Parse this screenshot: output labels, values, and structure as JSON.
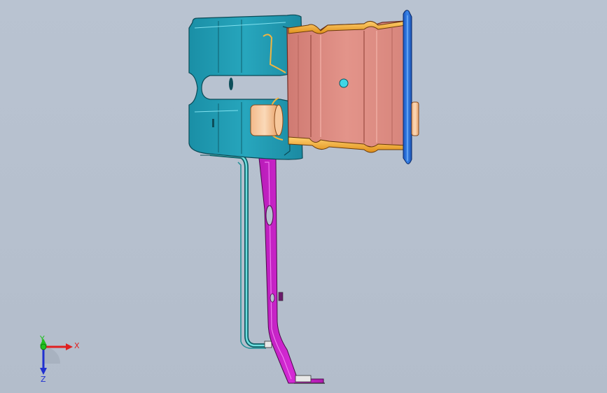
{
  "viewport": {
    "background": "#b7c1cf"
  },
  "model": {
    "parts": [
      {
        "name": "teal-bracket-housing",
        "color": "#1f9ab0"
      },
      {
        "name": "salmon-channel-body",
        "color": "#e08a80"
      },
      {
        "name": "orange-flange-edge",
        "color": "#f0a020"
      },
      {
        "name": "blue-end-flange",
        "color": "#2a6fd8"
      },
      {
        "name": "magenta-support-strap",
        "color": "#cc22cc"
      },
      {
        "name": "teal-support-strap",
        "color": "#2aa8a8"
      }
    ]
  },
  "triad": {
    "x_label": "X",
    "y_label": "Y",
    "z_label": "Z",
    "x_color": "#e02020",
    "y_color": "#20c020",
    "z_color": "#2030d0"
  }
}
